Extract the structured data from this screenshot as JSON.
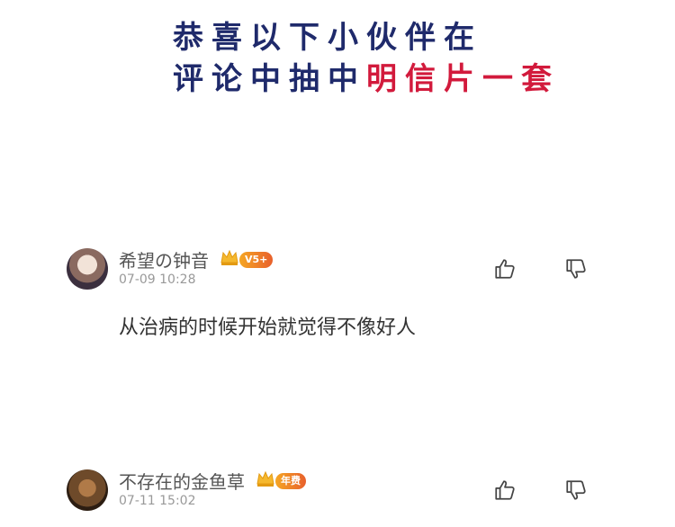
{
  "announcement": {
    "line1": "恭喜以下小伙伴在",
    "line2_prefix": "评论中抽中",
    "line2_highlight": "明信片一套"
  },
  "comments": [
    {
      "username": "希望の钟音",
      "badge": "V5+",
      "timestamp": "07-09 10:28",
      "text": "从治病的时候开始就觉得不像好人"
    },
    {
      "username": "不存在的金鱼草",
      "badge": "年费",
      "timestamp": "07-11 15:02",
      "text": ""
    }
  ],
  "icons": {
    "like": "thumbs-up-icon",
    "dislike": "thumbs-down-icon",
    "crown": "crown-icon"
  },
  "colors": {
    "headline": "#1f2a6b",
    "highlight": "#d21a3c",
    "badge": "#f5a623"
  }
}
